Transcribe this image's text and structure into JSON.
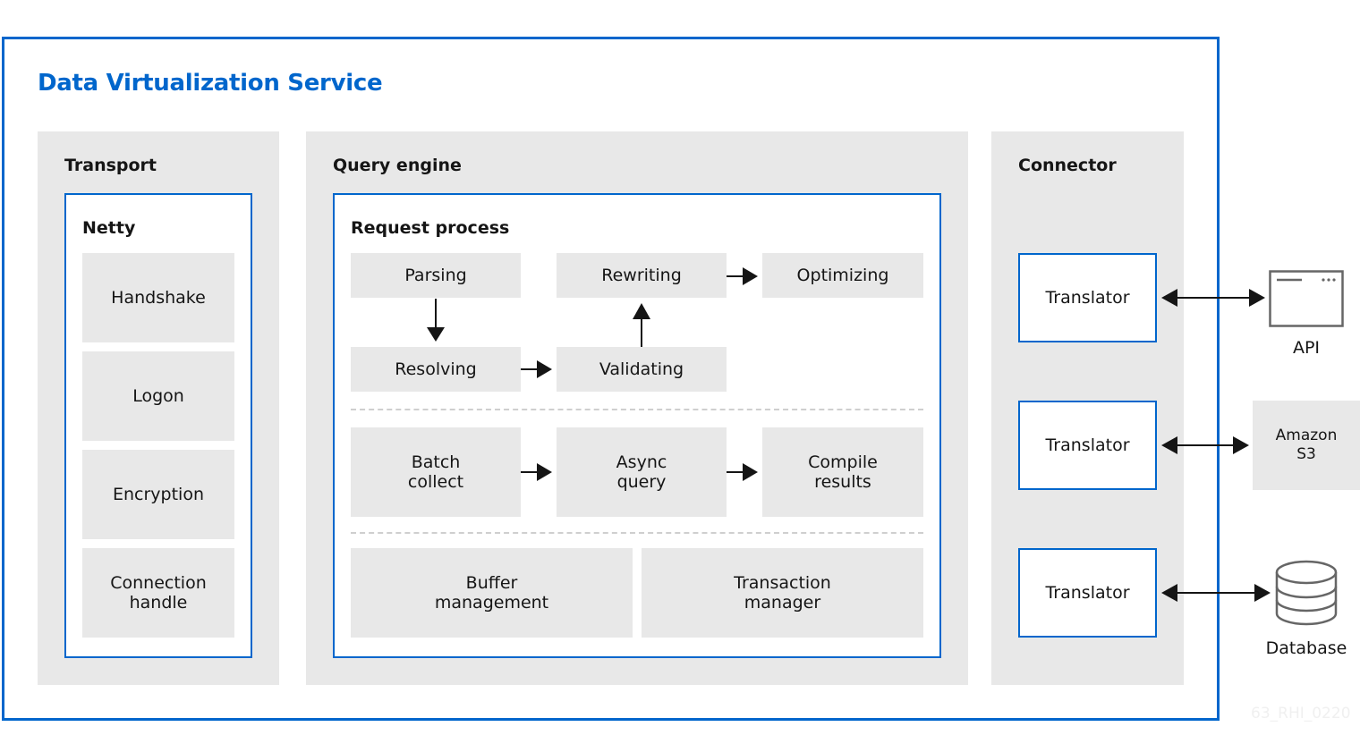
{
  "title": "Data Virtualization Service",
  "panels": {
    "transport": {
      "title": "Transport",
      "inner_title": "Netty",
      "items": [
        "Handshake",
        "Logon",
        "Encryption",
        "Connection\nhandle"
      ]
    },
    "query_engine": {
      "title": "Query engine",
      "inner_title": "Request process",
      "request_steps": [
        "Parsing",
        "Rewriting",
        "Optimizing",
        "Resolving",
        "Validating"
      ],
      "execution_steps": [
        "Batch\ncollect",
        "Async\nquery",
        "Compile\nresults"
      ],
      "management": [
        "Buffer\nmanagement",
        "Transaction\nmanager"
      ]
    },
    "connector": {
      "title": "Connector",
      "translators": [
        "Translator",
        "Translator",
        "Translator"
      ]
    }
  },
  "external": {
    "api": {
      "label": "API",
      "icon": "browser-window-icon"
    },
    "s3": {
      "label": "Amazon\nS3"
    },
    "database": {
      "label": "Database",
      "icon": "database-icon"
    }
  },
  "flows": [
    {
      "from": "Parsing",
      "to": "Resolving"
    },
    {
      "from": "Resolving",
      "to": "Validating"
    },
    {
      "from": "Validating",
      "to": "Rewriting"
    },
    {
      "from": "Rewriting",
      "to": "Optimizing"
    },
    {
      "from": "Batch collect",
      "to": "Async query"
    },
    {
      "from": "Async query",
      "to": "Compile results"
    },
    {
      "from": "Translator",
      "to": "API",
      "bidirectional": true
    },
    {
      "from": "Translator",
      "to": "Amazon S3",
      "bidirectional": true
    },
    {
      "from": "Translator",
      "to": "Database",
      "bidirectional": true
    }
  ],
  "colors": {
    "accent": "#0066cc",
    "box_fill": "#e8e8e8",
    "text": "#151515"
  },
  "watermark": "63_RHI_0220"
}
